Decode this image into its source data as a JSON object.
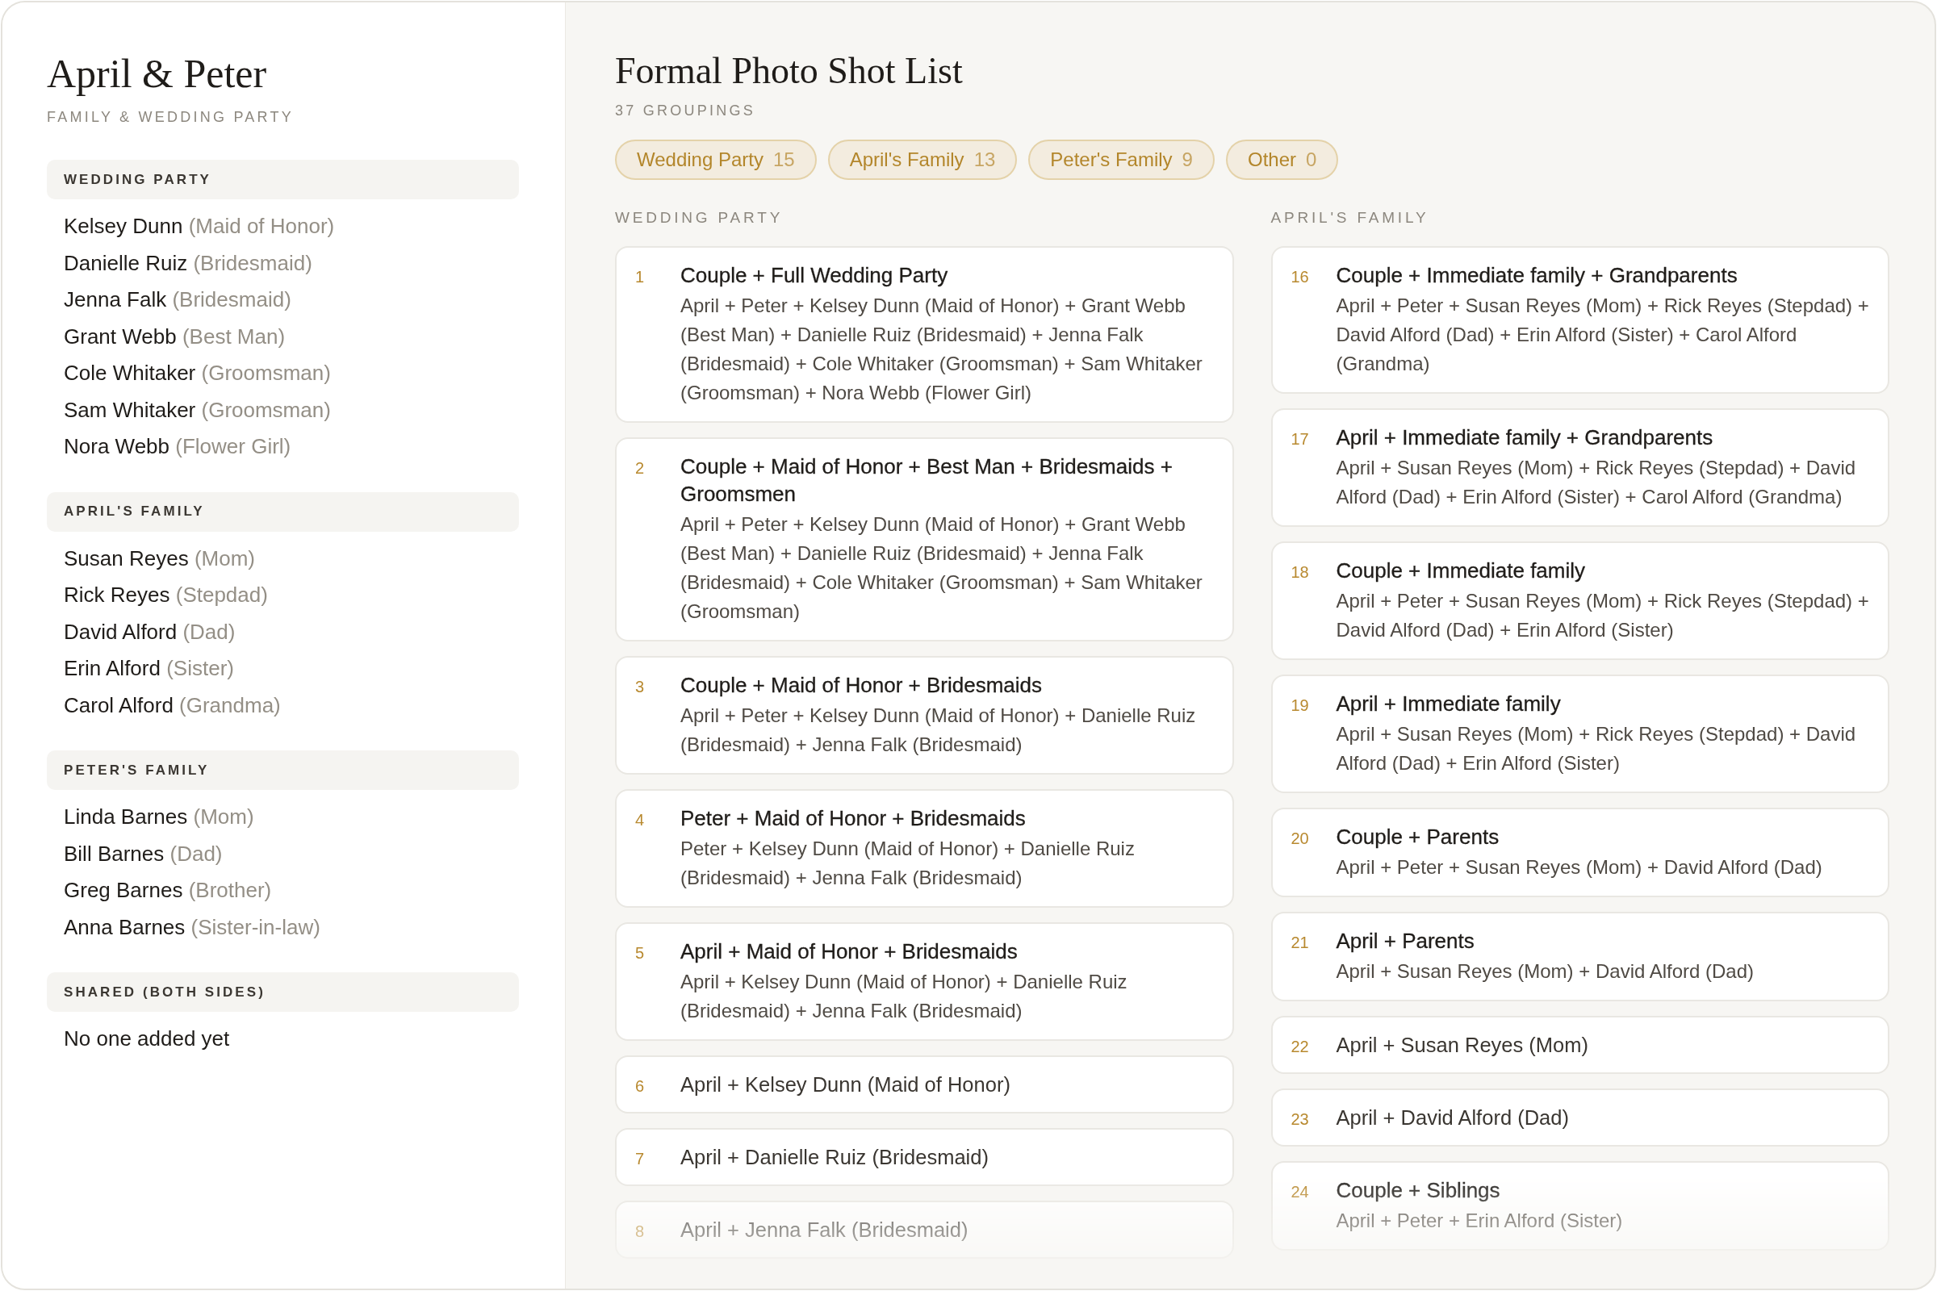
{
  "sidebar": {
    "title": "April & Peter",
    "subtitle": "FAMILY & WEDDING PARTY",
    "groups": [
      {
        "heading": "WEDDING PARTY",
        "people": [
          {
            "name": "Kelsey Dunn",
            "role": "(Maid of Honor)"
          },
          {
            "name": "Danielle Ruiz",
            "role": "(Bridesmaid)"
          },
          {
            "name": "Jenna Falk",
            "role": "(Bridesmaid)"
          },
          {
            "name": "Grant Webb",
            "role": "(Best Man)"
          },
          {
            "name": "Cole Whitaker",
            "role": "(Groomsman)"
          },
          {
            "name": "Sam Whitaker",
            "role": "(Groomsman)"
          },
          {
            "name": "Nora Webb",
            "role": "(Flower Girl)"
          }
        ]
      },
      {
        "heading": "APRIL'S FAMILY",
        "people": [
          {
            "name": "Susan Reyes",
            "role": "(Mom)"
          },
          {
            "name": "Rick Reyes",
            "role": "(Stepdad)"
          },
          {
            "name": "David Alford",
            "role": "(Dad)"
          },
          {
            "name": "Erin Alford",
            "role": "(Sister)"
          },
          {
            "name": "Carol Alford",
            "role": "(Grandma)"
          }
        ]
      },
      {
        "heading": "PETER'S FAMILY",
        "people": [
          {
            "name": "Linda Barnes",
            "role": "(Mom)"
          },
          {
            "name": "Bill Barnes",
            "role": "(Dad)"
          },
          {
            "name": "Greg Barnes",
            "role": "(Brother)"
          },
          {
            "name": "Anna Barnes",
            "role": "(Sister-in-law)"
          }
        ]
      },
      {
        "heading": "SHARED (BOTH SIDES)",
        "note": "No one added yet"
      }
    ]
  },
  "main": {
    "title": "Formal Photo Shot List",
    "count": "37 GROUPINGS",
    "filters": [
      {
        "label": "Wedding Party",
        "count": "15"
      },
      {
        "label": "April's Family",
        "count": "13"
      },
      {
        "label": "Peter's Family",
        "count": "9"
      },
      {
        "label": "Other",
        "count": "0"
      }
    ],
    "columns": [
      {
        "heading": "WEDDING PARTY",
        "shots": [
          {
            "kind": "group",
            "number": "1",
            "title": "Couple + Full Wedding Party",
            "people": "April + Peter + Kelsey Dunn (Maid of Honor) + Grant Webb (Best Man) + Danielle Ruiz (Bridesmaid) + Jenna Falk (Bridesmaid) + Cole Whitaker (Groomsman) + Sam Whitaker (Groomsman) + Nora Webb (Flower Girl)"
          },
          {
            "kind": "group",
            "number": "2",
            "title": "Couple + Maid of Honor + Best Man + Bridesmaids + Groomsmen",
            "people": "April + Peter + Kelsey Dunn (Maid of Honor) + Grant Webb (Best Man) + Danielle Ruiz (Bridesmaid) + Jenna Falk (Bridesmaid) + Cole Whitaker (Groomsman) + Sam Whitaker (Groomsman)"
          },
          {
            "kind": "group",
            "number": "3",
            "title": "Couple + Maid of Honor + Bridesmaids",
            "people": "April + Peter + Kelsey Dunn (Maid of Honor) + Danielle Ruiz (Bridesmaid) + Jenna Falk (Bridesmaid)"
          },
          {
            "kind": "group",
            "number": "4",
            "title": "Peter + Maid of Honor + Bridesmaids",
            "people": "Peter + Kelsey Dunn (Maid of Honor) + Danielle Ruiz (Bridesmaid) + Jenna Falk (Bridesmaid)"
          },
          {
            "kind": "group",
            "number": "5",
            "title": "April + Maid of Honor + Bridesmaids",
            "people": "April + Kelsey Dunn (Maid of Honor) + Danielle Ruiz (Bridesmaid) + Jenna Falk (Bridesmaid)"
          },
          {
            "kind": "single",
            "number": "6",
            "people": "April + Kelsey Dunn (Maid of Honor)"
          },
          {
            "kind": "single",
            "number": "7",
            "people": "April + Danielle Ruiz (Bridesmaid)"
          },
          {
            "kind": "single",
            "number": "8",
            "people": "April + Jenna Falk (Bridesmaid)"
          }
        ]
      },
      {
        "heading": "APRIL'S FAMILY",
        "shots": [
          {
            "kind": "group",
            "number": "16",
            "title": "Couple + Immediate family + Grandparents",
            "people": "April + Peter + Susan Reyes (Mom) + Rick Reyes (Stepdad) + David Alford (Dad) + Erin Alford (Sister) + Carol Alford (Grandma)"
          },
          {
            "kind": "group",
            "number": "17",
            "title": "April + Immediate family + Grandparents",
            "people": "April + Susan Reyes (Mom) + Rick Reyes (Stepdad) + David Alford (Dad) + Erin Alford (Sister) + Carol Alford (Grandma)"
          },
          {
            "kind": "group",
            "number": "18",
            "title": "Couple + Immediate family",
            "people": "April + Peter + Susan Reyes (Mom) + Rick Reyes (Stepdad) + David Alford (Dad) + Erin Alford (Sister)"
          },
          {
            "kind": "group",
            "number": "19",
            "title": "April + Immediate family",
            "people": "April + Susan Reyes (Mom) + Rick Reyes (Stepdad) + David Alford (Dad) + Erin Alford (Sister)"
          },
          {
            "kind": "group",
            "number": "20",
            "title": "Couple + Parents",
            "people": "April + Peter + Susan Reyes (Mom) + David Alford (Dad)"
          },
          {
            "kind": "group",
            "number": "21",
            "title": "April + Parents",
            "people": "April + Susan Reyes (Mom) + David Alford (Dad)"
          },
          {
            "kind": "single",
            "number": "22",
            "people": "April + Susan Reyes (Mom)"
          },
          {
            "kind": "single",
            "number": "23",
            "people": "April + David Alford (Dad)"
          },
          {
            "kind": "group",
            "number": "24",
            "title": "Couple + Siblings",
            "people": "April + Peter + Erin Alford (Sister)"
          }
        ]
      }
    ]
  }
}
